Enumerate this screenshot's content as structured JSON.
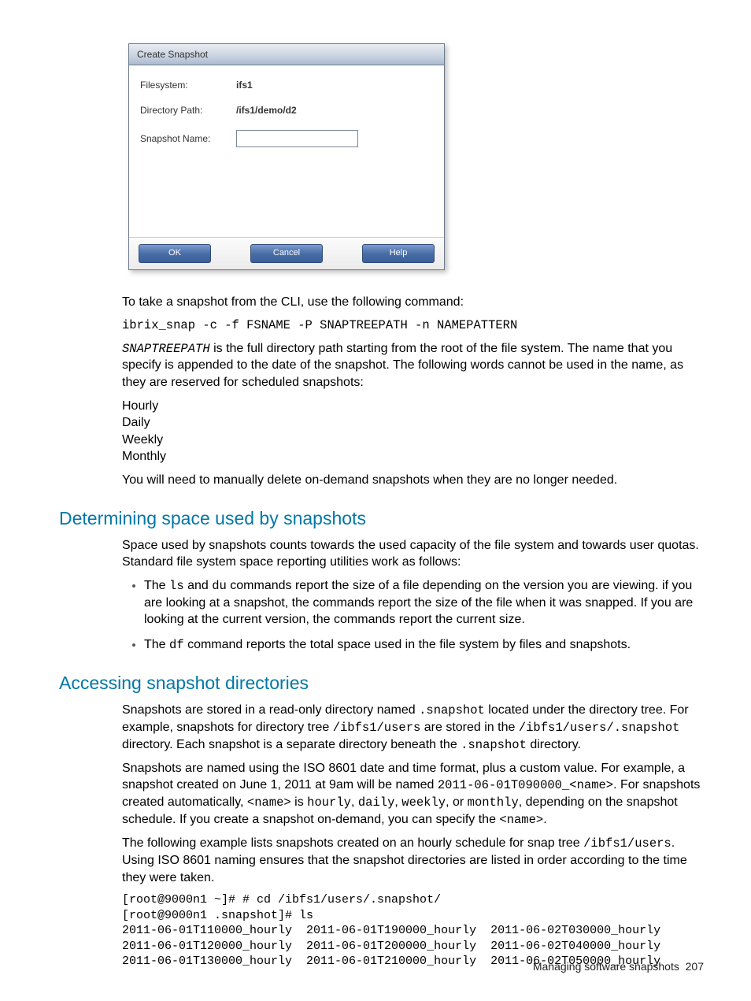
{
  "dialog": {
    "title": "Create Snapshot",
    "rows": {
      "fs_label": "Filesystem:",
      "fs_value": "ifs1",
      "dir_label": "Directory Path:",
      "dir_value": "/ifs1/demo/d2",
      "name_label": "Snapshot Name:"
    },
    "buttons": {
      "ok": "OK",
      "cancel": "Cancel",
      "help": "Help"
    }
  },
  "body": {
    "p_cli_intro": "To take a snapshot from the CLI, use the following command:",
    "cmd": "ibrix_snap -c -f FSNAME -P SNAPTREEPATH -n NAMEPATTERN",
    "p_snaptree_1a": "SNAPTREEPATH",
    "p_snaptree_1b": " is the full directory path starting from the root of the file system. The name that you specify is appended to the date of the snapshot. The following words cannot be used in the name, as they are reserved for scheduled snapshots:",
    "reserved": [
      "Hourly",
      "Daily",
      "Weekly",
      "Monthly"
    ],
    "p_manual_delete": "You will need to manually delete on-demand snapshots when they are no longer needed."
  },
  "sec_space": {
    "title": "Determining space used by snapshots",
    "p_intro": "Space used by snapshots counts towards the used capacity of the file system and towards user quotas. Standard file system space reporting utilities work as follows:",
    "b1_a": "The ",
    "b1_ls": "ls",
    "b1_b": " and ",
    "b1_du": "du",
    "b1_c": " commands report the size of a file depending on the version you are viewing. if you are looking at a snapshot, the commands report the size of the file when it was snapped. If you are looking at the current version, the commands report the current size.",
    "b2_a": "The ",
    "b2_df": "df",
    "b2_b": " command reports the total space used in the file system by files and snapshots."
  },
  "sec_access": {
    "title": "Accessing snapshot directories",
    "p1_a": "Snapshots are stored in a read-only directory named ",
    "p1_snapshot": ".snapshot",
    "p1_b": " located under the directory tree. For example, snapshots for directory tree ",
    "p1_path1": "/ibfs1/users",
    "p1_c": " are stored in the ",
    "p1_path2": "/ibfs1/users/.snapshot",
    "p1_d": " directory. Each snapshot is a separate directory beneath the ",
    "p1_snapshot2": ".snapshot",
    "p1_e": " directory.",
    "p2_a": "Snapshots are named using the ISO 8601 date and time format, plus a custom value. For example, a snapshot created on June 1, 2011 at 9am will be named ",
    "p2_ex": "2011-06-01T090000_<name>",
    "p2_b": ". For snapshots created automatically, ",
    "p2_name": "<name>",
    "p2_c": " is ",
    "p2_hourly": "hourly",
    "p2_d": ", ",
    "p2_daily": "daily",
    "p2_e": ", ",
    "p2_weekly": "weekly",
    "p2_f": ", or ",
    "p2_monthly": "monthly",
    "p2_g": ", depending on the snapshot schedule. If you create a snapshot on-demand, you can specify the ",
    "p2_name2": "<name>",
    "p2_h": ".",
    "p3_a": "The following example lists snapshots created on an hourly schedule for snap tree ",
    "p3_path": "/ibfs1/users",
    "p3_b": ". Using ISO 8601 naming ensures that the snapshot directories are listed in order according to the time they were taken.",
    "listing": "[root@9000n1 ~]# # cd /ibfs1/users/.snapshot/\n[root@9000n1 .snapshot]# ls\n2011-06-01T110000_hourly  2011-06-01T190000_hourly  2011-06-02T030000_hourly\n2011-06-01T120000_hourly  2011-06-01T200000_hourly  2011-06-02T040000_hourly\n2011-06-01T130000_hourly  2011-06-01T210000_hourly  2011-06-02T050000_hourly"
  },
  "footer": {
    "text": "Managing software snapshots",
    "page": "207"
  }
}
